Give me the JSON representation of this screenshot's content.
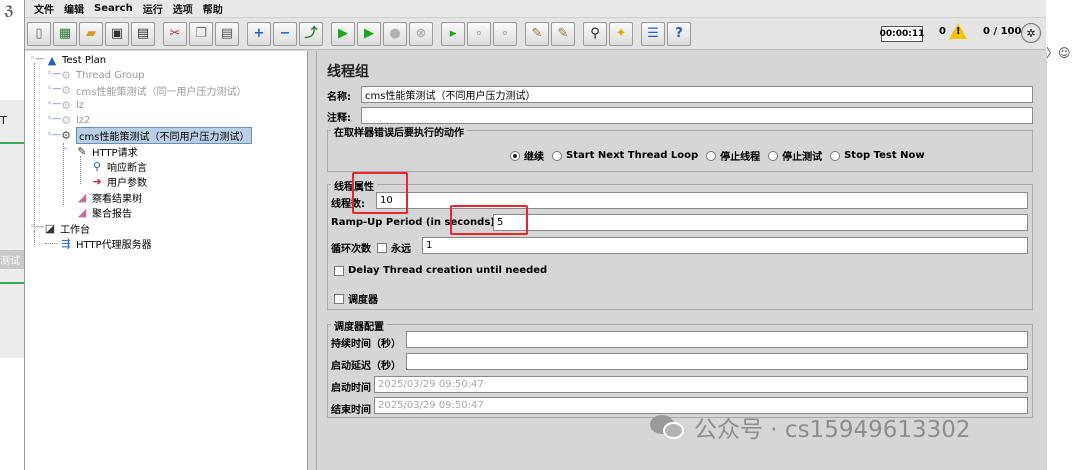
{
  "menu": [
    "文件",
    "编辑",
    "Search",
    "运行",
    "选项",
    "帮助"
  ],
  "status": {
    "timer": "00:00:11",
    "error_count": "0",
    "thread_count": "0 / 100"
  },
  "tree": {
    "test_plan": "Test Plan",
    "thread_group_1": "Thread Group",
    "thread_group_2": "cms性能策测试（同一用户压力测试）",
    "thread_group_3": "lz",
    "thread_group_4": "lz2",
    "thread_group_5": "cms性能策测试（不同用户压力测试）",
    "http_request": "HTTP请求",
    "response_assert": "响应断言",
    "user_params": "用户参数",
    "view_results_tree": "察看结果树",
    "aggregate_report": "聚合报告",
    "workbench": "工作台",
    "http_proxy": "HTTP代理服务器"
  },
  "panel": {
    "title": "线程组",
    "name_label": "名称:",
    "name_value": "cms性能策测试（不同用户压力测试）",
    "comment_label": "注释:",
    "comment_value": "",
    "error_action": {
      "legend": "在取样器错误后要执行的动作",
      "options": [
        "继续",
        "Start Next Thread Loop",
        "停止线程",
        "停止测试",
        "Stop Test Now"
      ],
      "selected": "继续"
    },
    "thread_props": {
      "legend": "线程属性",
      "threads_label": "线程数:",
      "threads_value": "10",
      "rampup_label": "Ramp-Up Period (in seconds):",
      "rampup_value": "5",
      "loop_label": "循环次数",
      "forever_label": "永远",
      "loop_value": "1",
      "delay_label": "Delay Thread creation until needed",
      "scheduler_label": "调度器"
    },
    "scheduler": {
      "legend": "调度器配置",
      "duration_label": "持续时间（秒）",
      "duration_value": "",
      "delay_label": "启动延迟（秒）",
      "delay_value": "",
      "start_label": "启动时间",
      "start_value": "2025/03/29 09:50:47",
      "end_label": "结束时间",
      "end_value": "2025/03/29 09:50:47"
    }
  },
  "watermark": "公众号 · cs15949613302",
  "outer": {
    "left_fragment_1": "T",
    "left_fragment_2": "测试",
    "right_fragment": "〉☺"
  },
  "colors": {
    "highlight_box": "#e8282f",
    "warning": "#f5c400",
    "selected_node": "#b8cfe5"
  }
}
